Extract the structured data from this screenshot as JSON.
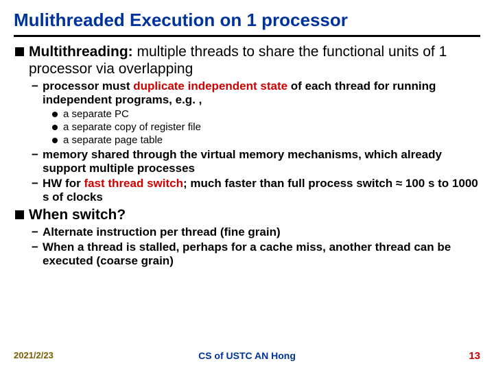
{
  "title": "Mulithreaded Execution on 1 processor",
  "bullets": {
    "b1a_pre": "Multithreading: ",
    "b1a_post": "multiple threads to share the functional units of 1 processor via overlapping",
    "b2a_pre": "processor must ",
    "b2a_red": "duplicate independent state",
    "b2a_post": " of each thread for running independent programs, e.g. ,",
    "b3a": "a separate PC",
    "b3b": "a separate copy of register file",
    "b3c": "a separate page table",
    "b2b": "memory shared through the virtual memory mechanisms, which already support multiple processes",
    "b2c_pre": "HW for ",
    "b2c_red": "fast thread switch",
    "b2c_post": "; much faster than full process switch ≈ 100 s to 1000 s of clocks",
    "b1b": "When switch?",
    "b2d": "Alternate instruction per thread (fine grain)",
    "b2e": "When a thread is stalled, perhaps for a cache miss, another thread can be executed (coarse grain)"
  },
  "footer": {
    "date": "2021/2/23",
    "center": "CS of USTC AN Hong",
    "page": "13"
  }
}
